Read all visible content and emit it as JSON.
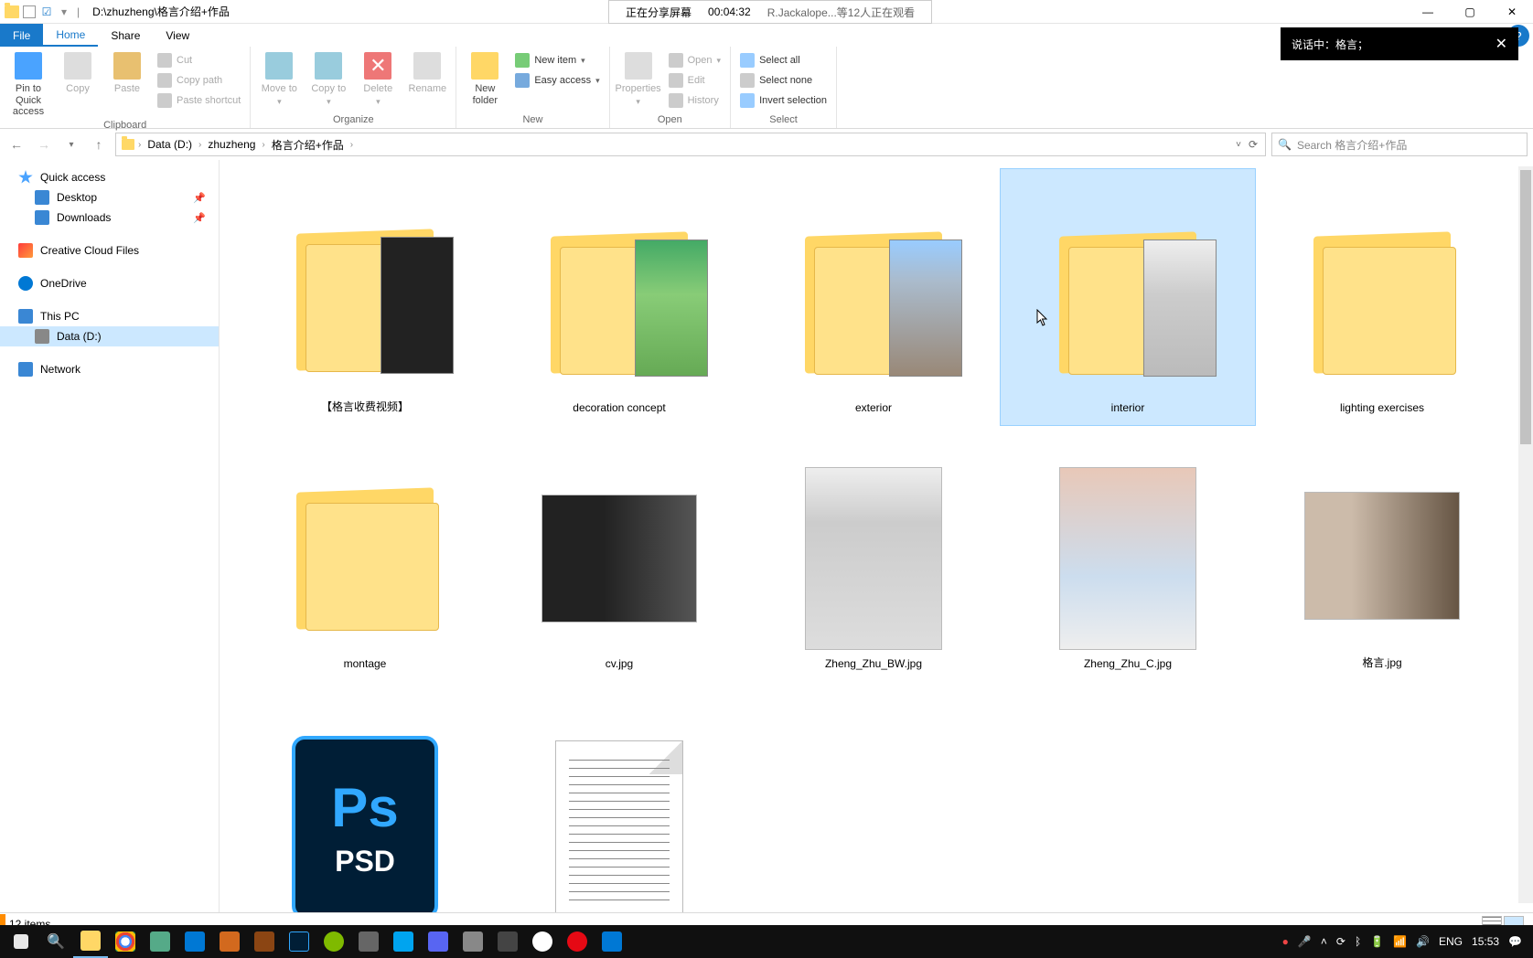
{
  "title": {
    "path": "D:\\zhuzheng\\格言介绍+作品"
  },
  "overlay": {
    "sharing": "正在分享屏幕",
    "time": "00:04:32",
    "viewers": "R.Jackalope...等12人正在观看"
  },
  "toast": {
    "text": "说话中：格言；"
  },
  "tabs": {
    "file": "File",
    "home": "Home",
    "share": "Share",
    "view": "View"
  },
  "ribbon": {
    "clipboard": {
      "pin": "Pin to Quick access",
      "copy": "Copy",
      "paste": "Paste",
      "cut": "Cut",
      "copypath": "Copy path",
      "pasteshortcut": "Paste shortcut",
      "label": "Clipboard"
    },
    "organize": {
      "moveto": "Move to",
      "copyto": "Copy to",
      "delete": "Delete",
      "rename": "Rename",
      "label": "Organize"
    },
    "new": {
      "newfolder": "New folder",
      "newitem": "New item",
      "easyaccess": "Easy access",
      "label": "New"
    },
    "open": {
      "properties": "Properties",
      "open": "Open",
      "edit": "Edit",
      "history": "History",
      "label": "Open"
    },
    "select": {
      "selectall": "Select all",
      "selectnone": "Select none",
      "invert": "Invert selection",
      "label": "Select"
    }
  },
  "breadcrumb": {
    "root": "Data (D:)",
    "p1": "zhuzheng",
    "p2": "格言介绍+作品"
  },
  "search": {
    "placeholder": "Search 格言介绍+作品"
  },
  "sidebar": {
    "quick": "Quick access",
    "desktop": "Desktop",
    "downloads": "Downloads",
    "cc": "Creative Cloud Files",
    "onedrive": "OneDrive",
    "thispc": "This PC",
    "datad": "Data (D:)",
    "network": "Network"
  },
  "items": [
    {
      "name": "【格言收费视频】",
      "type": "folder-preview"
    },
    {
      "name": "decoration concept",
      "type": "folder-preview"
    },
    {
      "name": "exterior",
      "type": "folder-preview"
    },
    {
      "name": "interior",
      "type": "folder-preview",
      "selected": true
    },
    {
      "name": "lighting exercises",
      "type": "folder-empty"
    },
    {
      "name": "montage",
      "type": "folder-empty"
    },
    {
      "name": "cv.jpg",
      "type": "img-dark"
    },
    {
      "name": "Zheng_Zhu_BW.jpg",
      "type": "img-bw"
    },
    {
      "name": "Zheng_Zhu_C.jpg",
      "type": "img-color"
    },
    {
      "name": "格言.jpg",
      "type": "img-office"
    },
    {
      "name": "",
      "type": "psd"
    },
    {
      "name": "",
      "type": "text"
    }
  ],
  "status": {
    "count": "12 items"
  },
  "tray": {
    "ime": "ENG",
    "time": "15:53"
  }
}
